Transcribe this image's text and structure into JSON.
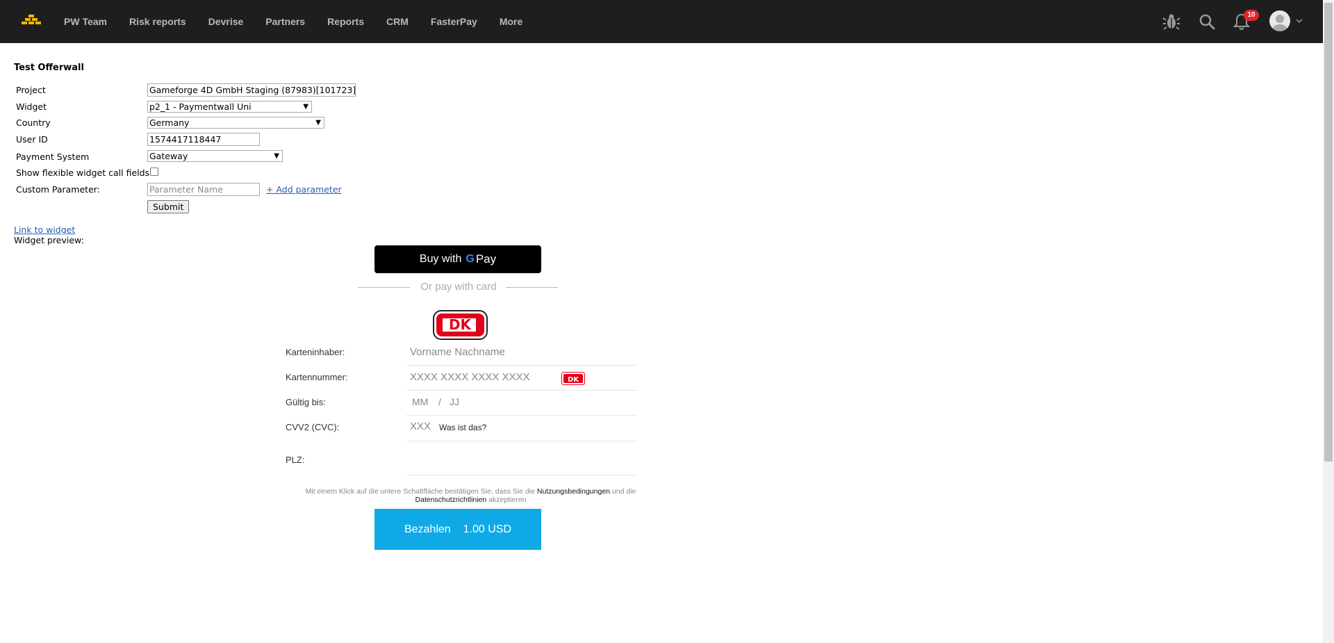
{
  "nav": {
    "logo": "gold-bars-logo",
    "items": [
      "PW Team",
      "Risk reports",
      "Devrise",
      "Partners",
      "Reports",
      "CRM",
      "FasterPay",
      "More"
    ],
    "notification_count": "10",
    "icons": [
      "bug-icon",
      "search-icon",
      "bell-icon",
      "avatar",
      "chevron-down-icon"
    ]
  },
  "form": {
    "title": "Test Offerwall",
    "project_label": "Project",
    "project_value": "Gameforge 4D GmbH Staging (87983)[101723]",
    "widget_label": "Widget",
    "widget_value": "p2_1 - Paymentwall Uni",
    "country_label": "Country",
    "country_value": "Germany",
    "userid_label": "User ID",
    "userid_value": "1574417118447",
    "payment_system_label": "Payment System",
    "payment_system_value": "Gateway",
    "flexible_label": "Show flexible widget call fields",
    "custom_param_label": "Custom Parameter:",
    "param_placeholder": "Parameter Name",
    "add_param": "+ Add parameter",
    "submit": "Submit",
    "link_to_widget": "Link to widget",
    "widget_preview": "Widget preview:"
  },
  "widget": {
    "gpay_prefix": "Buy with",
    "gpay_g": "G",
    "gpay_pay": "Pay",
    "or_pay": "Or pay with card",
    "cardholder_label": "Karteninhaber:",
    "cardholder_placeholder": "Vorname Nachname",
    "cardnumber_label": "Kartennummer:",
    "cardnumber_placeholder": "XXXX XXXX XXXX XXXX",
    "expiry_label": "Gültig bis:",
    "expiry_mm": "MM",
    "expiry_sep": "/",
    "expiry_yy": "JJ",
    "cvv_label": "CVV2 (CVC):",
    "cvv_placeholder": "XXX",
    "cvv_help": "Was ist das?",
    "plz_label": "PLZ:",
    "terms_prefix": "Mit einem Klick auf die untere Schaltfläche bestätigen Sie, dass Sie die",
    "terms_link1": "Nutzungsbedingungen",
    "terms_mid": "und die",
    "terms_link2": "Datenschutzrichtlinien",
    "terms_suffix": "akzeptieren",
    "pay_label": "Bezahlen",
    "pay_amount": "1.00 USD",
    "card_brand": "DK",
    "colors": {
      "pay_button": "#0fa9e6",
      "brand_red": "#e2001a",
      "nav_bg": "#1e1e1e",
      "badge": "#e0272c"
    }
  }
}
